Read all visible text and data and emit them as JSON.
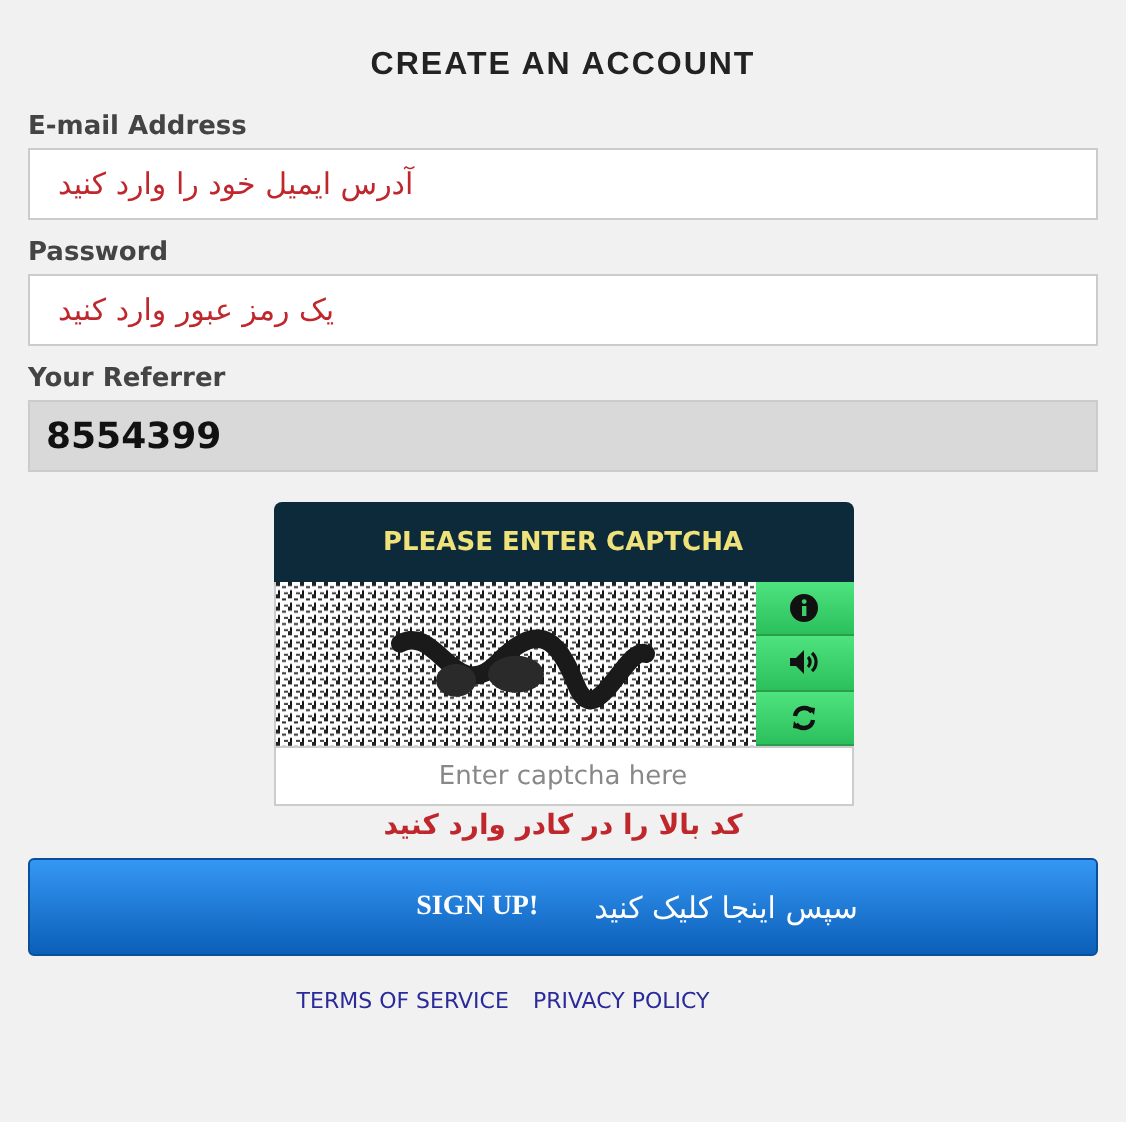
{
  "title": "CREATE AN ACCOUNT",
  "fields": [
    {
      "label": "E-mail Address",
      "value": "آدرس ایمیل خود را وارد کنید",
      "kind": "annotated"
    },
    {
      "label": "Password",
      "value": "یک رمز عبور وارد کنید",
      "kind": "annotated"
    },
    {
      "label": "Your Referrer",
      "value": "8554399",
      "kind": "readonly"
    }
  ],
  "captcha": {
    "heading": "PLEASE ENTER CAPTCHA",
    "placeholder": "Enter captcha here",
    "note": "کد بالا را در کادر وارد کنید"
  },
  "signup_button": {
    "label": "SIGN UP!",
    "note": "سپس اینجا کلیک کنید"
  },
  "links": [
    "TERMS OF SERVICE",
    "PRIVACY POLICY"
  ]
}
